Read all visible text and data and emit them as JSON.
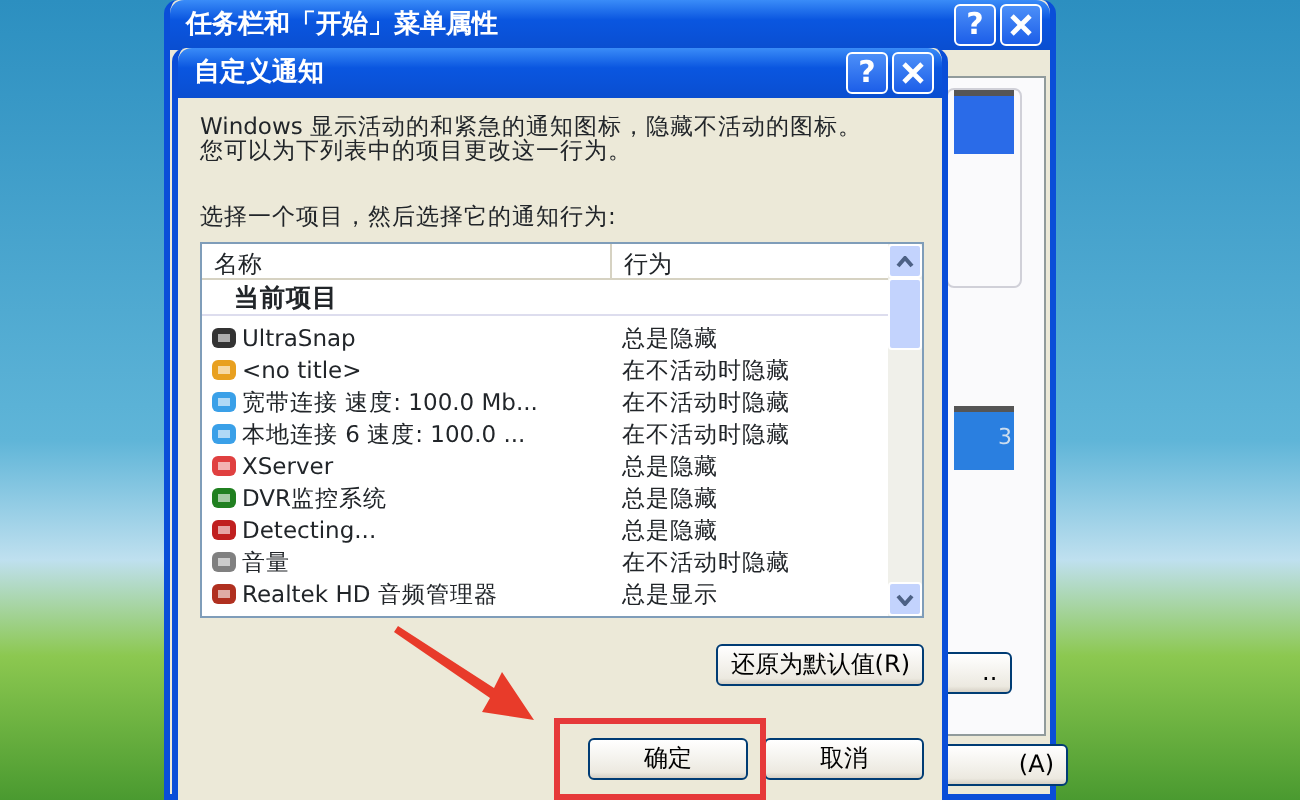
{
  "back_window": {
    "title": "任务栏和「开始」菜单属性",
    "help_glyph": "?",
    "preview_text": "3",
    "customize_button": "..",
    "apply_button": "(A)"
  },
  "dialog": {
    "title": "自定义通知",
    "help_glyph": "?",
    "description_lines": [
      "Windows 显示活动的和紧急的通知图标，隐藏不活动的图标。",
      "您可以为下列表中的项目更改这一行为。"
    ],
    "prompt": "选择一个项目，然后选择它的通知行为:",
    "columns": [
      "名称",
      "行为"
    ],
    "group": "当前项目",
    "items": [
      {
        "name": "UltraSnap",
        "behavior": "总是隐藏"
      },
      {
        "name": "<no title>",
        "behavior": "在不活动时隐藏"
      },
      {
        "name": "宽带连接 速度: 100.0 Mb...",
        "behavior": "在不活动时隐藏"
      },
      {
        "name": "本地连接 6 速度: 100.0 ...",
        "behavior": "在不活动时隐藏"
      },
      {
        "name": "XServer",
        "behavior": "总是隐藏"
      },
      {
        "name": "DVR监控系统",
        "behavior": "总是隐藏"
      },
      {
        "name": "Detecting...",
        "behavior": "总是隐藏"
      },
      {
        "name": "音量",
        "behavior": "在不活动时隐藏"
      },
      {
        "name": "Realtek HD 音频管理器",
        "behavior": "总是显示"
      }
    ],
    "restore_button": "还原为默认值(R)",
    "ok_button": "确定",
    "cancel_button": "取消"
  }
}
